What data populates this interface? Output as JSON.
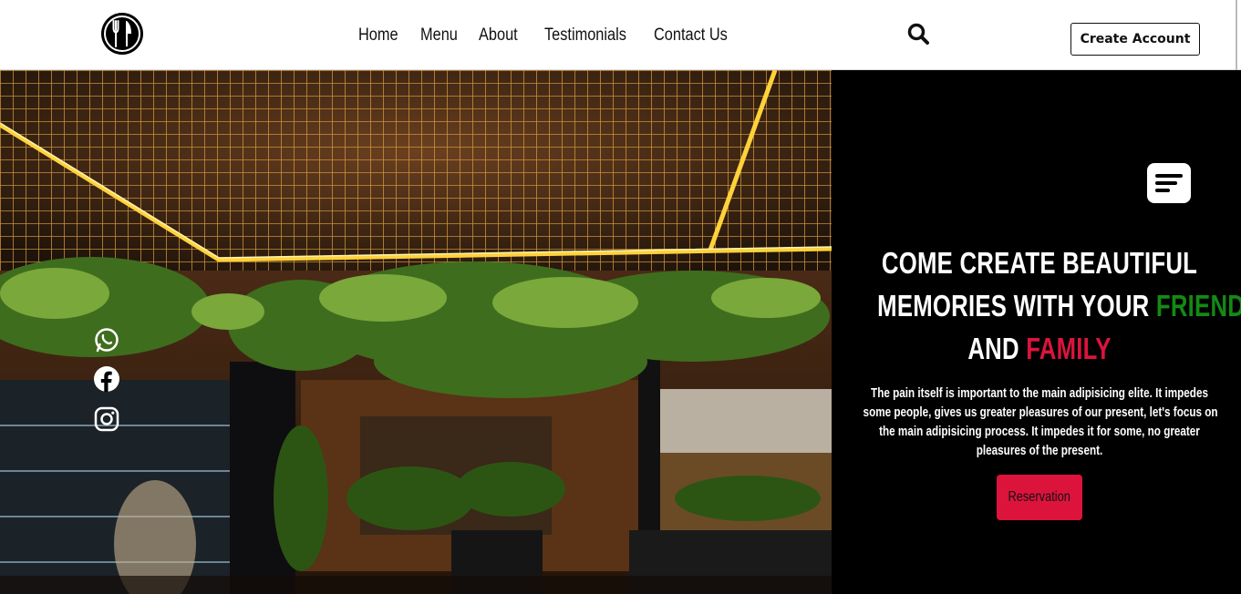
{
  "navbar": {
    "links": [
      "Home",
      "Menu",
      "About",
      "Testimonials",
      "Contact Us"
    ],
    "search_icon": "search-icon",
    "account_button": "Create Account",
    "logo_icon": "fork-knife-logo"
  },
  "hero": {
    "image_alt": "restaurant interior with illuminated ceiling grid and hanging plants",
    "social_icons": [
      "whatsapp-icon",
      "facebook-icon",
      "instagram-icon"
    ]
  },
  "panel": {
    "menu_icon": "menu-lines-icon",
    "headline": {
      "line1": "COME CREATE BEAUTIFUL",
      "line2_a": "MEMORIES WITH YOUR ",
      "line2_b": "FRIENDS",
      "line3_a": "AND ",
      "line3_b": "FAMILY"
    },
    "description": [
      "The pain itself is important to the main adipisicing elite. It impedes",
      "some people, gives us greater pleasures of our present, let's focus on",
      "the main adipisicing process. It impedes it for some, no greater",
      "pleasures of the present."
    ],
    "reservation_button": "Reservation"
  },
  "colors": {
    "accent_green": "#138a13",
    "accent_red": "#dc143c",
    "panel_bg": "#000000"
  }
}
